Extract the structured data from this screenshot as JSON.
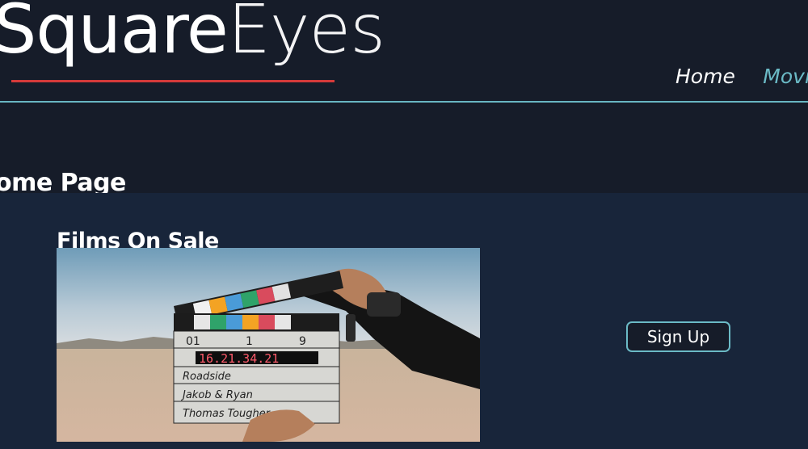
{
  "header": {
    "logo": {
      "part1": "Square",
      "part2": "Eyes"
    },
    "nav": [
      {
        "label": "Home"
      },
      {
        "label": "Movie"
      }
    ]
  },
  "page": {
    "title": "ome Page"
  },
  "section": {
    "title": "Films On Sale",
    "signup_label": "Sign Up"
  },
  "photo": {
    "clapper": {
      "digits": "16.21.34.21",
      "roll": "01",
      "scene": "1",
      "take": "9",
      "line1": "Roadside",
      "line2": "Jakob & Ryan",
      "line3": "Thomas Tougher"
    }
  },
  "colors": {
    "background": "#161c29",
    "section_bg": "#18253a",
    "accent": "#6bbac6",
    "logo_underline": "#d53a3a"
  }
}
